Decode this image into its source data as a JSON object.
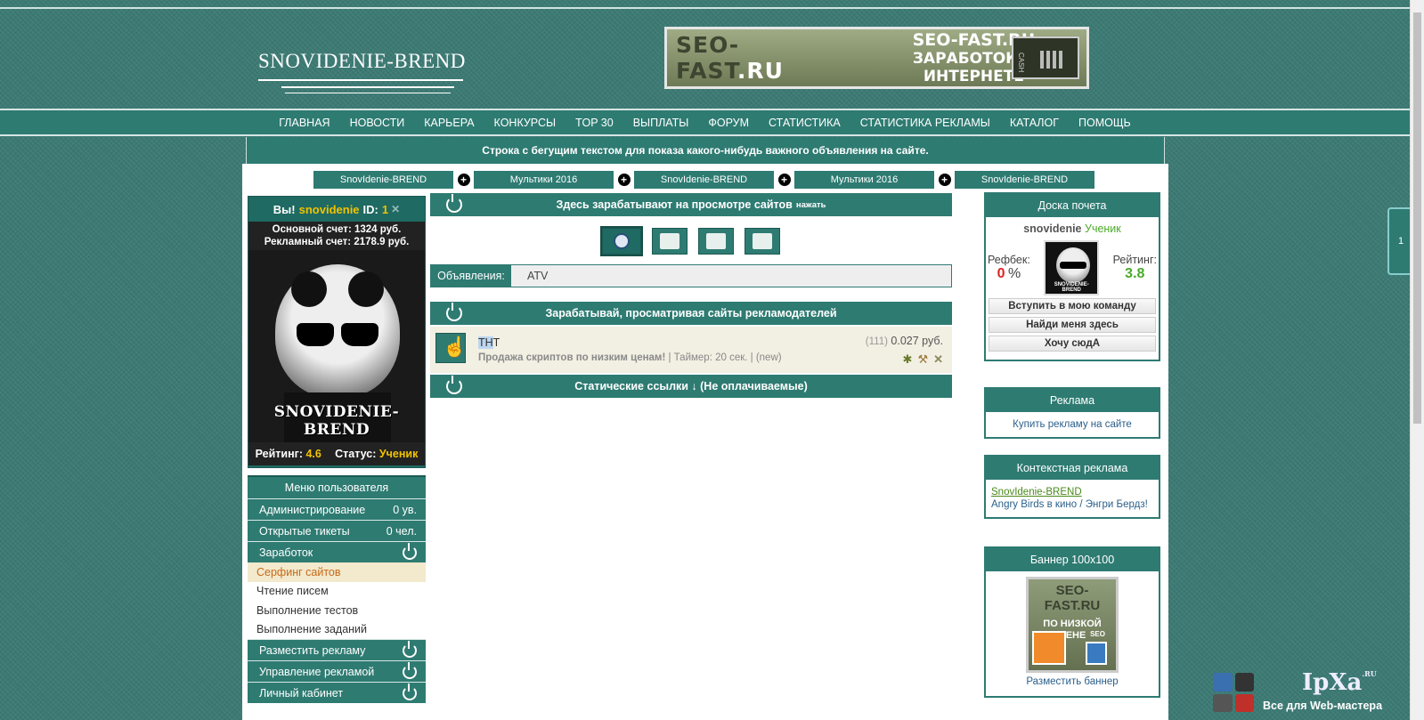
{
  "header": {
    "logo": "SNOVIDENIE-BREND",
    "banner": {
      "left_text": "SEO-FAST",
      "left_tld": ".RU",
      "right_line1": "SEO-FAST.RU",
      "right_line2": "ЗАРАБОТОК В ИНТЕРНЕТЕ",
      "monitor_label": "CASH"
    }
  },
  "nav": [
    "ГЛАВНАЯ",
    "НОВОСТИ",
    "КАРЬЕРА",
    "КОНКУРСЫ",
    "TOP 30",
    "ВЫПЛАТЫ",
    "ФОРУМ",
    "СТАТИСТИКА",
    "СТАТИСТИКА РЕКЛАМЫ",
    "КАТАЛОГ",
    "ПОМОЩЬ"
  ],
  "marquee": "Строка с бегущим текстом для показа какого-нибудь важного объявления на сайте.",
  "tabs": [
    "SnovIdenie-BREND",
    "Мультики 2016",
    "SnovIdenie-BREND",
    "Мультики 2016",
    "SnovIdenie-BREND"
  ],
  "user": {
    "prefix": "Вы!",
    "nick": "snovidenie",
    "id_label": "ID:",
    "id": "1",
    "main_account": "Основной счет: 1324 руб.",
    "ad_account": "Рекламный счет: 2178.9 руб.",
    "avatar_caption": "SNOVIDENIE-BREND",
    "rating_label": "Рейтинг:",
    "rating": "4.6",
    "status_label": "Статус:",
    "status": "Ученик"
  },
  "user_menu": {
    "title": "Меню пользователя",
    "admin": {
      "label": "Администрирование",
      "value": "0 ув."
    },
    "tickets": {
      "label": "Открытые тикеты",
      "value": "0 чел."
    },
    "earn": "Заработок",
    "earn_items": [
      "Серфинг сайтов",
      "Чтение писем",
      "Выполнение тестов",
      "Выполнение заданий"
    ],
    "place_ad": "Разместить рекламу",
    "manage_ad": "Управление рекламой",
    "cabinet": "Личный кабинет"
  },
  "center": {
    "head1": "Здесь зарабатывают на просмотре сайтов",
    "head1_small": "нажать",
    "ads_label": "Объявления:",
    "ads_text": "ATV",
    "head2": "Зарабатывай, просматривая сайты рекламодателей",
    "item": {
      "title_hl": "ТН",
      "title_rest": "Т",
      "desc": "Продажа скриптов по низким ценам!",
      "timer": "| Таймер: 20 сек. | (new)",
      "count": "(111)",
      "price": "0.027 руб."
    },
    "head3": "Статические ссылки ↓ (Не оплачиваемые)"
  },
  "right": {
    "hof_title": "Доска почета",
    "hof_nick": "snovidenie",
    "hof_rank": "Ученик",
    "refback_label": "Рефбек:",
    "refback_value": "0",
    "refback_unit": "%",
    "rating_label": "Рейтинг:",
    "rating_value": "3.8",
    "hof_avatar_caption": "SNOVIDENIE-BREND",
    "btn1": "Вступить в мою команду",
    "btn2": "Найди меня здесь",
    "btn3": "Хочу сюдА",
    "ad_title": "Реклама",
    "ad_link": "Купить рекламу на сайте",
    "ctx_title": "Контекстная реклама",
    "ctx_link1": "SnovIdenie-BREND",
    "ctx_link2": "Angry Birds в кино / Энгри Бердз!",
    "banner_title": "Баннер 100x100",
    "banner_l1": "SEO-FAST.RU",
    "banner_l2": "ПО НИЗКОЙ ЦЕНЕ",
    "banner_seo": "SEO",
    "banner_link": "Разместить баннер"
  },
  "side_tab": "1",
  "watermark": {
    "title": "IpXa",
    "tld": ".RU",
    "subtitle": "Все для Web-мастера"
  },
  "colors": {
    "primary": "#2e7b72",
    "accent": "#f2c200",
    "bg": "#3d7a74"
  }
}
